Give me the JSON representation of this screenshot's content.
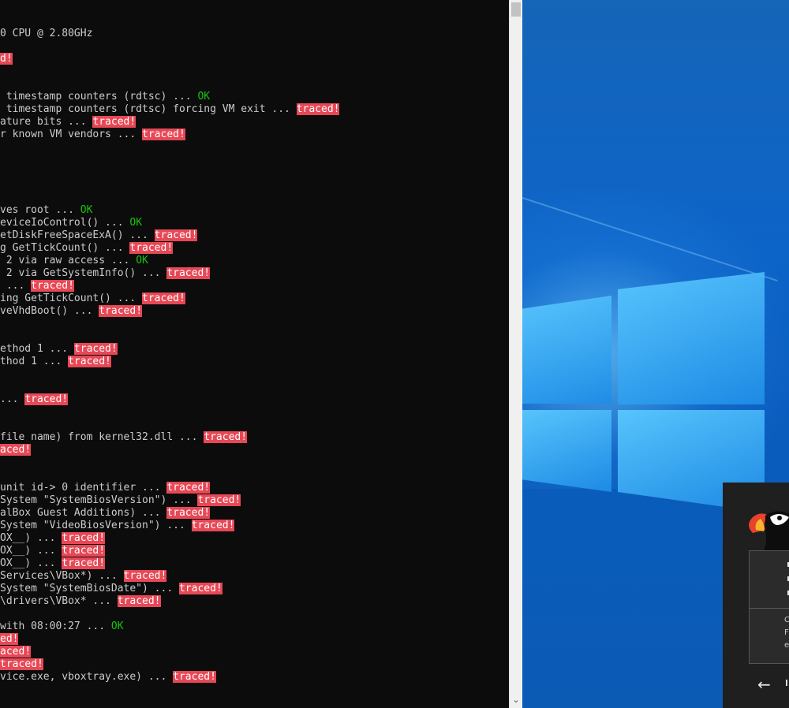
{
  "console": {
    "lines": [
      {
        "segments": [
          {
            "text": "0 CPU @ 2.80GHz",
            "style": "normal"
          }
        ]
      },
      {
        "segments": []
      },
      {
        "segments": [
          {
            "text": "d!",
            "style": "traced"
          }
        ]
      },
      {
        "segments": []
      },
      {
        "segments": []
      },
      {
        "segments": [
          {
            "text": " timestamp counters (rdtsc) ... ",
            "style": "normal"
          },
          {
            "text": "OK",
            "style": "ok"
          }
        ]
      },
      {
        "segments": [
          {
            "text": " timestamp counters (rdtsc) forcing VM exit ... ",
            "style": "normal"
          },
          {
            "text": "traced!",
            "style": "traced"
          }
        ]
      },
      {
        "segments": [
          {
            "text": "ature bits ... ",
            "style": "normal"
          },
          {
            "text": "traced!",
            "style": "traced"
          }
        ]
      },
      {
        "segments": [
          {
            "text": "r known VM vendors ... ",
            "style": "normal"
          },
          {
            "text": "traced!",
            "style": "traced"
          }
        ]
      },
      {
        "segments": []
      },
      {
        "segments": []
      },
      {
        "segments": []
      },
      {
        "segments": []
      },
      {
        "segments": []
      },
      {
        "segments": [
          {
            "text": "ves root ... ",
            "style": "normal"
          },
          {
            "text": "OK",
            "style": "ok"
          }
        ]
      },
      {
        "segments": [
          {
            "text": "eviceIoControl() ... ",
            "style": "normal"
          },
          {
            "text": "OK",
            "style": "ok"
          }
        ]
      },
      {
        "segments": [
          {
            "text": "etDiskFreeSpaceExA() ... ",
            "style": "normal"
          },
          {
            "text": "traced!",
            "style": "traced"
          }
        ]
      },
      {
        "segments": [
          {
            "text": "g GetTickCount() ... ",
            "style": "normal"
          },
          {
            "text": "traced!",
            "style": "traced"
          }
        ]
      },
      {
        "segments": [
          {
            "text": " 2 via raw access ... ",
            "style": "normal"
          },
          {
            "text": "OK",
            "style": "ok"
          }
        ]
      },
      {
        "segments": [
          {
            "text": " 2 via GetSystemInfo() ... ",
            "style": "normal"
          },
          {
            "text": "traced!",
            "style": "traced"
          }
        ]
      },
      {
        "segments": [
          {
            "text": " ... ",
            "style": "normal"
          },
          {
            "text": "traced!",
            "style": "traced"
          }
        ]
      },
      {
        "segments": [
          {
            "text": "ing GetTickCount() ... ",
            "style": "normal"
          },
          {
            "text": "traced!",
            "style": "traced"
          }
        ]
      },
      {
        "segments": [
          {
            "text": "veVhdBoot() ... ",
            "style": "normal"
          },
          {
            "text": "traced!",
            "style": "traced"
          }
        ]
      },
      {
        "segments": []
      },
      {
        "segments": []
      },
      {
        "segments": [
          {
            "text": "ethod 1 ... ",
            "style": "normal"
          },
          {
            "text": "traced!",
            "style": "traced"
          }
        ]
      },
      {
        "segments": [
          {
            "text": "thod 1 ... ",
            "style": "normal"
          },
          {
            "text": "traced!",
            "style": "traced"
          }
        ]
      },
      {
        "segments": []
      },
      {
        "segments": []
      },
      {
        "segments": [
          {
            "text": "... ",
            "style": "normal"
          },
          {
            "text": "traced!",
            "style": "traced"
          }
        ]
      },
      {
        "segments": []
      },
      {
        "segments": []
      },
      {
        "segments": [
          {
            "text": "file name) from kernel32.dll ... ",
            "style": "normal"
          },
          {
            "text": "traced!",
            "style": "traced"
          }
        ]
      },
      {
        "segments": [
          {
            "text": "aced!",
            "style": "traced"
          }
        ]
      },
      {
        "segments": []
      },
      {
        "segments": []
      },
      {
        "segments": [
          {
            "text": "unit id-> 0 identifier ... ",
            "style": "normal"
          },
          {
            "text": "traced!",
            "style": "traced"
          }
        ]
      },
      {
        "segments": [
          {
            "text": "System \"SystemBiosVersion\") ... ",
            "style": "normal"
          },
          {
            "text": "traced!",
            "style": "traced"
          }
        ]
      },
      {
        "segments": [
          {
            "text": "alBox Guest Additions) ... ",
            "style": "normal"
          },
          {
            "text": "traced!",
            "style": "traced"
          }
        ]
      },
      {
        "segments": [
          {
            "text": "System \"VideoBiosVersion\") ... ",
            "style": "normal"
          },
          {
            "text": "traced!",
            "style": "traced"
          }
        ]
      },
      {
        "segments": [
          {
            "text": "OX__) ... ",
            "style": "normal"
          },
          {
            "text": "traced!",
            "style": "traced"
          }
        ]
      },
      {
        "segments": [
          {
            "text": "OX__) ... ",
            "style": "normal"
          },
          {
            "text": "traced!",
            "style": "traced"
          }
        ]
      },
      {
        "segments": [
          {
            "text": "OX__) ... ",
            "style": "normal"
          },
          {
            "text": "traced!",
            "style": "traced"
          }
        ]
      },
      {
        "segments": [
          {
            "text": "Services\\VBox*) ... ",
            "style": "normal"
          },
          {
            "text": "traced!",
            "style": "traced"
          }
        ]
      },
      {
        "segments": [
          {
            "text": "System \"SystemBiosDate\") ... ",
            "style": "normal"
          },
          {
            "text": "traced!",
            "style": "traced"
          }
        ]
      },
      {
        "segments": [
          {
            "text": "\\drivers\\VBox* ... ",
            "style": "normal"
          },
          {
            "text": "traced!",
            "style": "traced"
          }
        ]
      },
      {
        "segments": []
      },
      {
        "segments": [
          {
            "text": "with 08:00:27 ... ",
            "style": "normal"
          },
          {
            "text": "OK",
            "style": "ok"
          }
        ]
      },
      {
        "segments": [
          {
            "text": "ed!",
            "style": "traced"
          }
        ]
      },
      {
        "segments": [
          {
            "text": "aced!",
            "style": "traced"
          }
        ]
      },
      {
        "segments": [
          {
            "text": "traced!",
            "style": "traced"
          }
        ]
      },
      {
        "segments": [
          {
            "text": "vice.exe, vboxtray.exe) ... ",
            "style": "normal"
          },
          {
            "text": "traced!",
            "style": "traced"
          }
        ]
      }
    ]
  },
  "scrollbar": {
    "down_arrow": "⌄"
  },
  "desktop": {
    "wallpaper": "windows-10-logo"
  },
  "toast": {
    "logo_icon": "puffin-logo-icon",
    "body_fragments": [
      "C",
      "F",
      "e"
    ],
    "back_arrow": "←",
    "colors": {
      "background": "#1f1f1f",
      "card": "#2b2b2b"
    }
  },
  "colors": {
    "console_bg": "#0c0c0c",
    "console_text": "#cccccc",
    "ok": "#16c60c",
    "traced_bg": "#e74856"
  }
}
